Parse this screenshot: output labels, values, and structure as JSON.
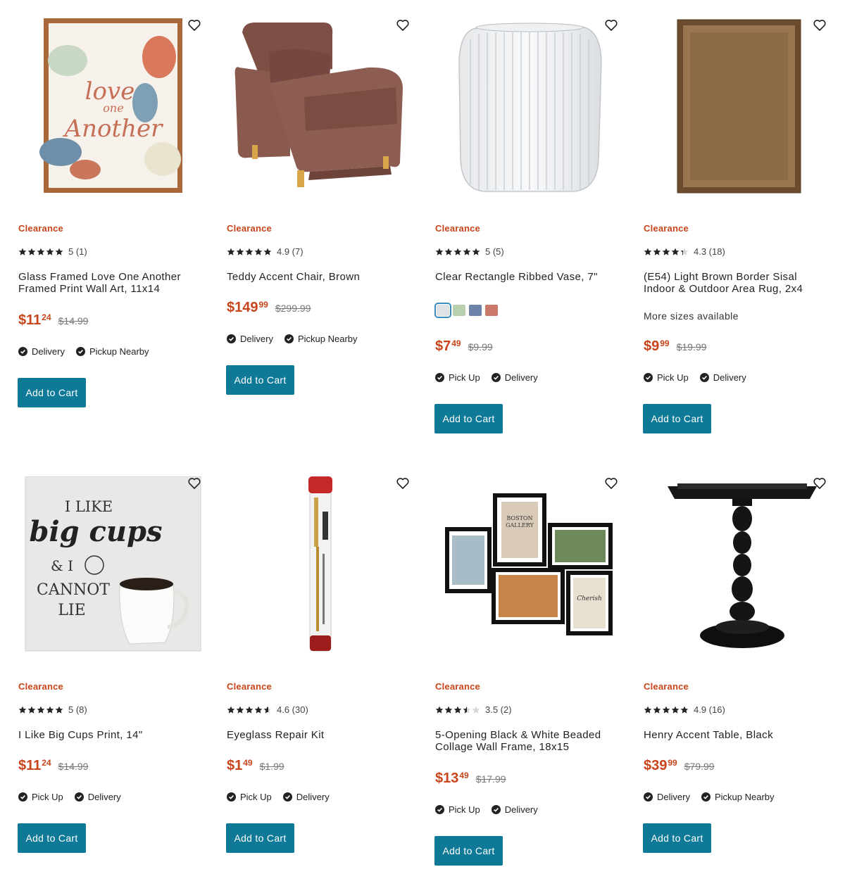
{
  "products": [
    {
      "badge": "Clearance",
      "rating_value": 5,
      "rating_text": "5 (1)",
      "title": "Glass Framed Love One Another Framed Print Wall Art, 11x14",
      "price_dollars": "$11",
      "price_cents": "24",
      "was_price": "$14.99",
      "fulfillment": [
        "Delivery",
        "Pickup Nearby"
      ],
      "button_label": "Add to Cart",
      "image_icon": "framed-floral-print-image",
      "image_text": [
        "love",
        "one",
        "Another"
      ]
    },
    {
      "badge": "Clearance",
      "rating_value": 4.9,
      "rating_text": "4.9 (7)",
      "title": "Teddy Accent Chair, Brown",
      "price_dollars": "$149",
      "price_cents": "99",
      "was_price": "$299.99",
      "fulfillment": [
        "Delivery",
        "Pickup Nearby"
      ],
      "button_label": "Add to Cart",
      "image_icon": "accent-chair-image"
    },
    {
      "badge": "Clearance",
      "rating_value": 5,
      "rating_text": "5 (5)",
      "title": "Clear Rectangle Ribbed Vase, 7\"",
      "swatches": [
        "#dfe3e6",
        "#b9d0ae",
        "#6c82a8",
        "#c9786a"
      ],
      "price_dollars": "$7",
      "price_cents": "49",
      "was_price": "$9.99",
      "fulfillment": [
        "Pick Up",
        "Delivery"
      ],
      "button_label": "Add to Cart",
      "image_icon": "ribbed-glass-vase-image"
    },
    {
      "badge": "Clearance",
      "rating_value": 4.3,
      "rating_text": "4.3 (18)",
      "title": "(E54) Light Brown Border Sisal Indoor & Outdoor Area Rug, 2x4",
      "more_text": "More sizes available",
      "price_dollars": "$9",
      "price_cents": "99",
      "was_price": "$19.99",
      "fulfillment": [
        "Pick Up",
        "Delivery"
      ],
      "button_label": "Add to Cart",
      "image_icon": "sisal-area-rug-image"
    },
    {
      "badge": "Clearance",
      "rating_value": 5,
      "rating_text": "5 (8)",
      "title": "I Like Big Cups Print, 14\"",
      "price_dollars": "$11",
      "price_cents": "24",
      "was_price": "$14.99",
      "fulfillment": [
        "Pick Up",
        "Delivery"
      ],
      "button_label": "Add to Cart",
      "image_icon": "coffee-cup-print-image",
      "image_text": [
        "I LIKE",
        "big cups",
        "& I",
        "CANNOT",
        "LIE"
      ]
    },
    {
      "badge": "Clearance",
      "rating_value": 4.6,
      "rating_text": "4.6 (30)",
      "title": "Eyeglass Repair Kit",
      "price_dollars": "$1",
      "price_cents": "49",
      "was_price": "$1.99",
      "fulfillment": [
        "Pick Up",
        "Delivery"
      ],
      "button_label": "Add to Cart",
      "image_icon": "eyeglass-repair-tube-image"
    },
    {
      "badge": "Clearance",
      "rating_value": 3.5,
      "rating_text": "3.5 (2)",
      "title": "5-Opening Black & White Beaded Collage Wall Frame, 18x15",
      "price_dollars": "$13",
      "price_cents": "49",
      "was_price": "$17.99",
      "fulfillment": [
        "Pick Up",
        "Delivery"
      ],
      "button_label": "Add to Cart",
      "image_icon": "collage-frame-image",
      "image_text": [
        "BOSTON",
        "GALLERY",
        "Cherish"
      ]
    },
    {
      "badge": "Clearance",
      "rating_value": 4.9,
      "rating_text": "4.9 (16)",
      "title": "Henry Accent Table, Black",
      "price_dollars": "$39",
      "price_cents": "99",
      "was_price": "$79.99",
      "fulfillment": [
        "Delivery",
        "Pickup Nearby"
      ],
      "button_label": "Add to Cart",
      "image_icon": "black-accent-table-image"
    }
  ],
  "colors": {
    "clearance": "#c8441a",
    "price": "#c8441a",
    "button": "#0e7a97",
    "star": "#222222"
  },
  "icons": {
    "favorite": "heart-icon",
    "check": "check-circle-icon",
    "star": "star-icon"
  }
}
